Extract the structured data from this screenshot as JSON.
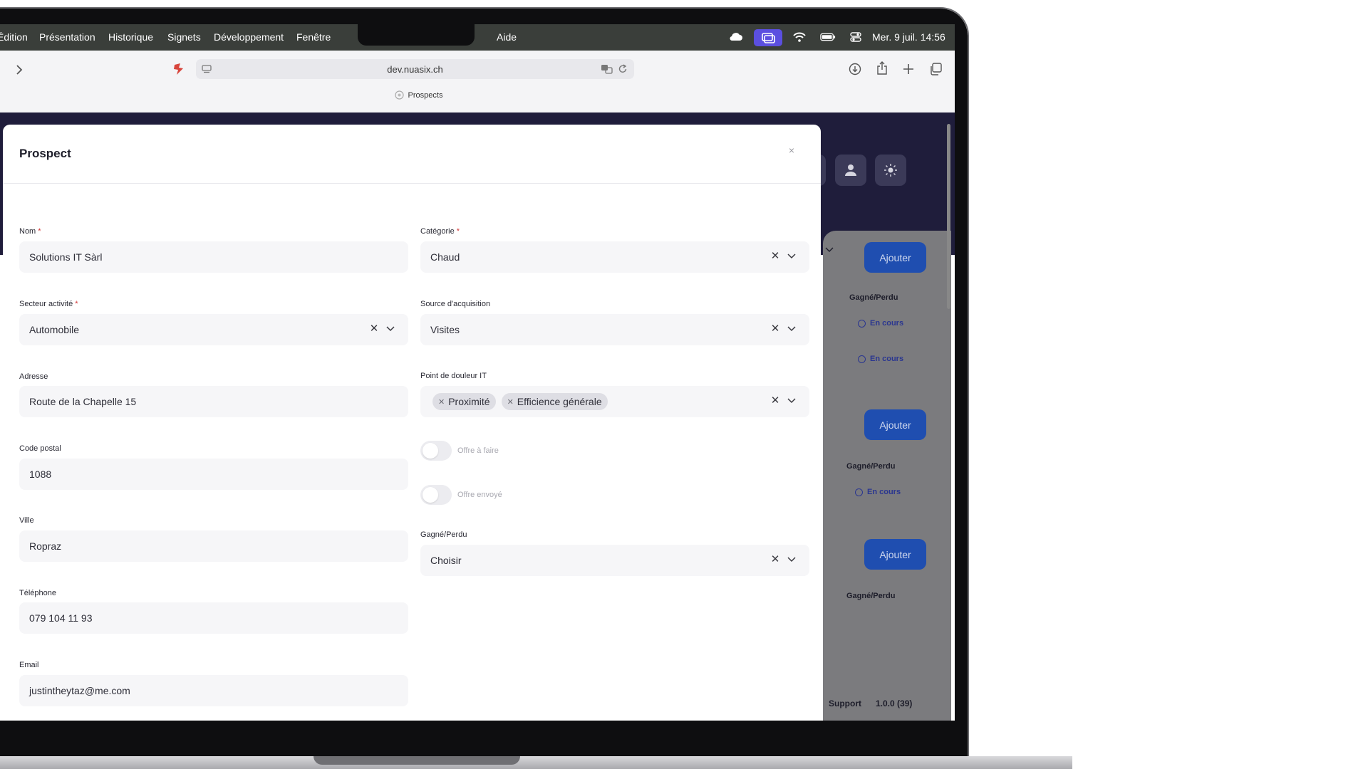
{
  "menubar": {
    "items": [
      "Édition",
      "Présentation",
      "Historique",
      "Signets",
      "Développement",
      "Fenêtre",
      "Aide"
    ],
    "datetime": "Mer. 9 juil.  14:56"
  },
  "browser": {
    "url": "dev.nuasix.ch",
    "tab_title": "Prospects"
  },
  "background_app": {
    "add_label": "Ajouter",
    "won_lost_label": "Gagné/Perdu",
    "status_in_progress": "En cours",
    "footer_support": "Support",
    "footer_version": "1.0.0 (39)"
  },
  "modal": {
    "title": "Prospect",
    "close": "×",
    "left": {
      "nom": {
        "label": "Nom",
        "value": "Solutions IT Sàrl",
        "required": "*"
      },
      "secteur": {
        "label": "Secteur activité",
        "value": "Automobile",
        "required": "*"
      },
      "adresse": {
        "label": "Adresse",
        "value": "Route de la Chapelle 15"
      },
      "code_postal": {
        "label": "Code postal",
        "value": "1088"
      },
      "ville": {
        "label": "Ville",
        "value": "Ropraz"
      },
      "telephone": {
        "label": "Téléphone",
        "value": "079 104 11 93"
      },
      "email": {
        "label": "Email",
        "value": "justintheytaz@me.com"
      }
    },
    "right": {
      "categorie": {
        "label": "Catégorie",
        "value": "Chaud",
        "required": "*"
      },
      "source": {
        "label": "Source d'acquisition",
        "value": "Visites"
      },
      "point_douleur": {
        "label": "Point de douleur IT",
        "chips": [
          "Proximité",
          "Efficience générale"
        ]
      },
      "offre_a_faire": {
        "label": "Offre à faire",
        "on": false
      },
      "offre_envoye": {
        "label": "Offre envoyé",
        "on": false
      },
      "gagne_perdu": {
        "label": "Gagné/Perdu",
        "value": "Choisir"
      }
    },
    "clear_symbol": "✕"
  },
  "colors": {
    "menubar": "#3a3e3a",
    "app_header": "#1f1d3b",
    "primary_button": "#1f4eb0",
    "required": "#d23a3a",
    "field_bg": "#f6f6f8"
  }
}
